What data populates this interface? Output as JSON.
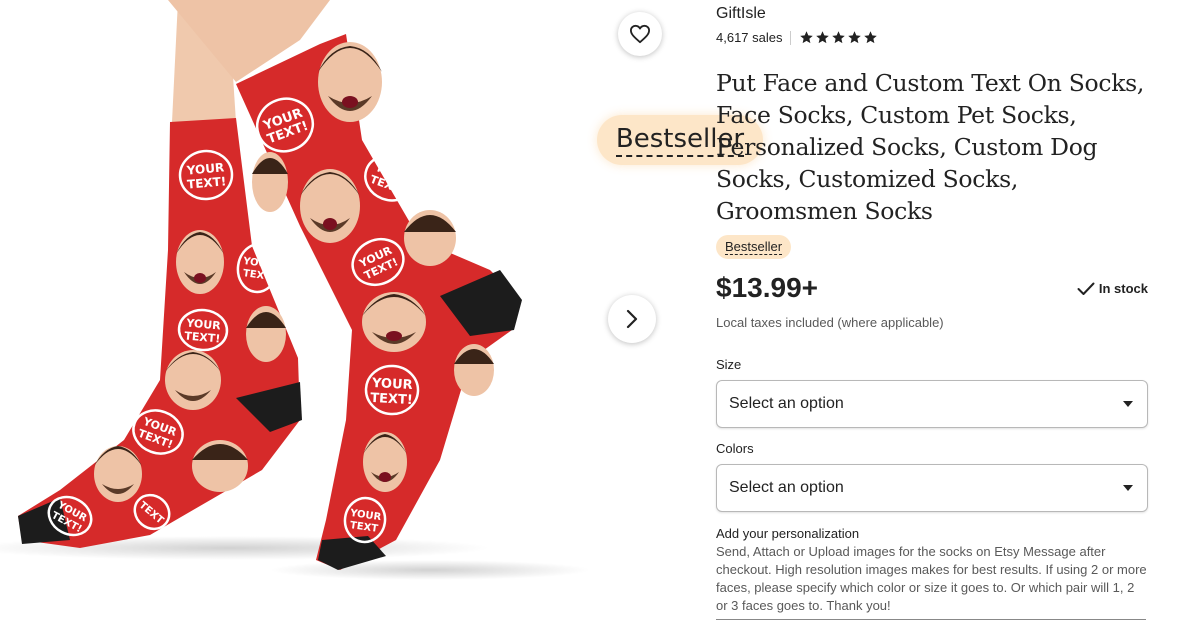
{
  "listing": {
    "shop_name": "GiftIsle",
    "sales": "4,617 sales",
    "rating_stars": 5,
    "title": "Put Face and Custom Text On Socks, Face Socks, Custom Pet Socks, Personalized Socks, Custom Dog Socks, Customized Socks, Groomsmen Socks",
    "badge": "Bestseller",
    "price": "$13.99+",
    "stock": "In stock",
    "tax_note": "Local taxes included (where applicable)"
  },
  "tooltip": {
    "text": "Bestseller"
  },
  "options": {
    "size_label": "Size",
    "size_value": "Select an option",
    "colors_label": "Colors",
    "colors_value": "Select an option"
  },
  "personalization": {
    "title": "Add your personalization",
    "text": "Send, Attach or Upload images for the socks on Etsy Message after checkout. High resolution images makes for best results. If using 2 or more faces, please specify which color or size it goes to. Or which pair will 1, 2 or 3 faces goes to. Thank you!"
  },
  "image": {
    "print_text": "YOUR TEXT!",
    "icons": [
      "heart-icon",
      "chevron-right-icon",
      "checkmark-icon",
      "star-icon"
    ]
  },
  "colors": {
    "sock_red": "#d62a2a",
    "sock_black": "#1c1c1c",
    "badge_bg": "#fde6c8",
    "skin": "#eec3a6"
  }
}
